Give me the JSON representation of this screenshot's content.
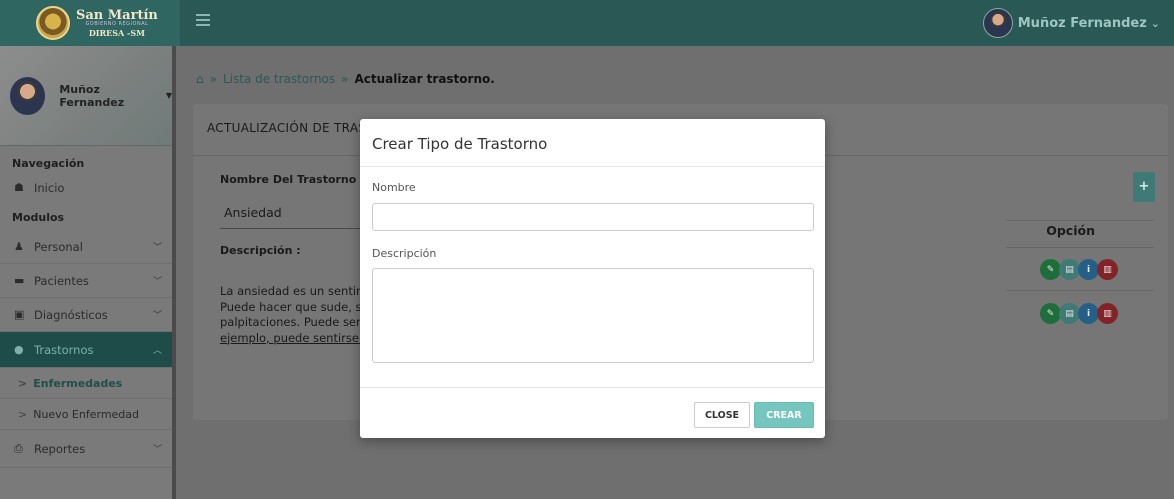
{
  "brand": {
    "title": "San Martín",
    "subtitle": "GOBIERNO REGIONAL",
    "region": "DIRESA -SM"
  },
  "topbar": {
    "user_name": "Muñoz Fernandez",
    "caret": "⌄"
  },
  "sidebar": {
    "profile_name": "Muñoz Fernandez",
    "caret": "▼",
    "nav_heading": "Navegación",
    "modules_heading": "Modulos",
    "items": [
      {
        "label": "Inicio",
        "icon": "home-icon"
      },
      {
        "label": "Personal",
        "icon": "user-tie-icon"
      },
      {
        "label": "Pacientes",
        "icon": "bed-icon"
      },
      {
        "label": "Diagnósticos",
        "icon": "briefcase-medical-icon"
      },
      {
        "label": "Trastornos",
        "icon": "brain-icon"
      },
      {
        "label": "Reportes",
        "icon": "print-icon"
      }
    ],
    "subitems": [
      {
        "label": "Enfermedades"
      },
      {
        "label": "Nuevo Enfermedad"
      }
    ]
  },
  "breadcrumb": {
    "link": "Lista de trastornos",
    "separator": "»",
    "current": "Actualizar trastorno."
  },
  "panel": {
    "title": "ACTUALIZACIÓN DE TRAS",
    "name_label": "Nombre Del Trastorno :",
    "name_value": "Ansiedad",
    "desc_label": "Descripción :",
    "desc_lines": [
      "La ansiedad es un sentim",
      "Puede hacer que sude, se",
      "palpitaciones. Puede ser",
      "ejemplo, puede sentirse a"
    ],
    "add_label": "+",
    "option_header": "Opción"
  },
  "modal": {
    "title": "Crear Tipo de Trastorno",
    "name_label": "Nombre",
    "name_value": "",
    "desc_label": "Descripción",
    "desc_value": "",
    "close_label": "CLOSE",
    "create_label": "CREAR"
  },
  "colors": {
    "brand_teal": "#2a5955",
    "accent": "#76c6c0",
    "edit": "#28a745",
    "view": "#5aaea8",
    "info": "#3498db",
    "delete": "#c9302c"
  }
}
